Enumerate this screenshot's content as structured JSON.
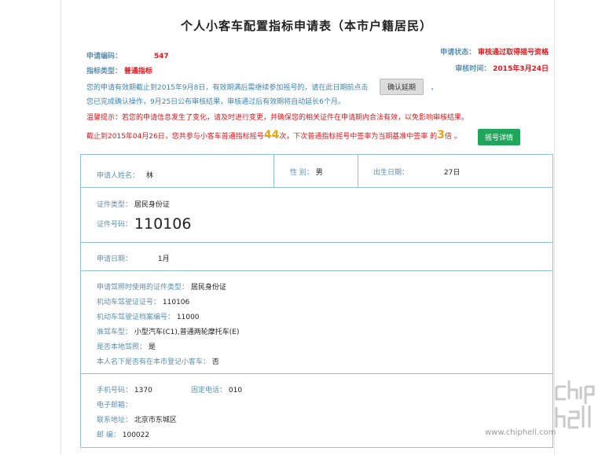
{
  "title": "个人小客车配置指标申请表（本市户籍居民）",
  "header": {
    "app_no_label": "申请编码：",
    "app_no_value": "547",
    "status_label": "申请状态：",
    "status_value": "审核通过取得摇号资格",
    "type_label": "指标类型：",
    "type_value": "普通指标",
    "review_time_label": "审核时间：",
    "review_time_value": "2015年3月24日"
  },
  "notice": {
    "line1": "您的申请有效期截止到2015年9月8日，有效期满后需继续参加摇号的，请在此日期前点击",
    "confirm_button": "确认延期",
    "line1_tail": "，",
    "line2": "您已完成确认操作，9月25日公布审核结果，审核通过后有效期将自动延长6个月。",
    "warning": "温馨提示：若您的申请信息发生了变化，请及时进行变更，并确保您的相关证件在申请期内合法有效，以免影响审核结果。",
    "lottery_prefix": "截止到2015年04月26日，您共参与小客车普通指标摇号",
    "lottery_count": "44",
    "lottery_mid": "次，下次普通指标摇号中签率为当期基准中签率 的",
    "lottery_multiple": "3",
    "lottery_suffix": "倍 。",
    "detail_button": "摇号详情"
  },
  "applicant": {
    "name_label": "申请人姓名：",
    "name_value": "林",
    "gender_label": "性  别：",
    "gender_value": "男",
    "birth_label": "出生日期：",
    "birth_value": "27日"
  },
  "id_card": {
    "type_label": "证件类型：",
    "type_value": "居民身份证",
    "no_label": "证件号码：",
    "no_value": "110106"
  },
  "apply_date": {
    "label": "申请日期：",
    "value": "1月"
  },
  "license": {
    "cert_type_label": "申请驾照时使用的证件类型：",
    "cert_type_value": "居民身份证",
    "license_no_label": "机动车驾驶证证号：",
    "license_no_value": "110106",
    "archive_no_label": "机动车驾驶证档案编号：",
    "archive_no_value": "11000",
    "class_label": "准驾车型：",
    "class_value": "小型汽车(C1),普通两轮摩托车(E)",
    "local_label": "是否本地驾照：",
    "local_value": "是",
    "has_car_label": "本人名下是否有在本市登记小客车：",
    "has_car_value": "否"
  },
  "contact": {
    "mobile_label": "手机号码：",
    "mobile_value": "1370",
    "phone_label": "固定电话：",
    "phone_value": "010",
    "email_label": "电子邮箱：",
    "email_value": "",
    "address_label": "联系地址：",
    "address_value": "北京市东城区",
    "zip_label": "邮    编：",
    "zip_value": "100022"
  },
  "watermark": {
    "url": "www.chiphell.com"
  }
}
